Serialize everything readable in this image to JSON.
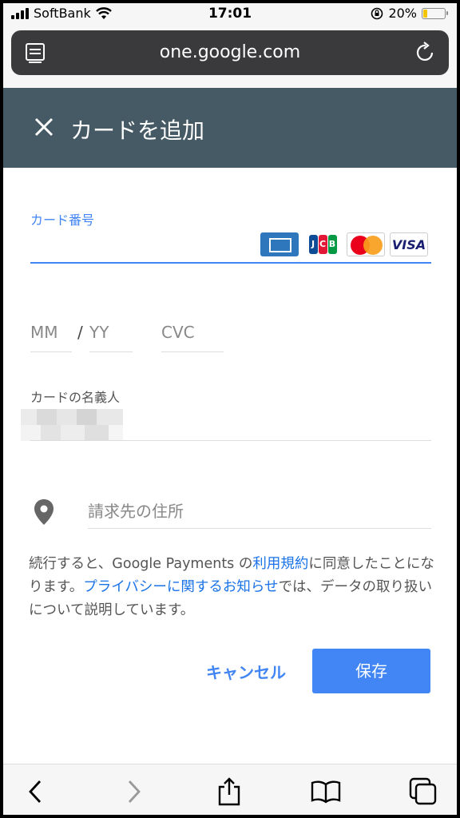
{
  "status_bar": {
    "carrier": "SoftBank",
    "time": "17:01",
    "battery_percent": "20%",
    "battery_level": 0.2
  },
  "browser": {
    "url": "one.google.com"
  },
  "header": {
    "title": "カードを追加"
  },
  "form": {
    "card_number_label": "カード番号",
    "card_brands": [
      "amex-icon",
      "jcb-icon",
      "mastercard-icon",
      "visa-icon"
    ],
    "expiry_month_placeholder": "MM",
    "expiry_separator": "/",
    "expiry_year_placeholder": "YY",
    "cvc_placeholder": "CVC",
    "cardholder_label": "カードの名義人",
    "billing_address_placeholder": "請求先の住所"
  },
  "notice": {
    "part1": "続行すると、Google Payments の",
    "terms_link": "利用規約",
    "part2": "に同意したことになります。",
    "privacy_link": "プライバシーに関するお知らせ",
    "part3": "では、データの取り扱いについて説明しています。"
  },
  "actions": {
    "cancel_label": "キャンセル",
    "save_label": "保存"
  },
  "colors": {
    "header_bg": "#455a64",
    "accent": "#4285f4"
  }
}
